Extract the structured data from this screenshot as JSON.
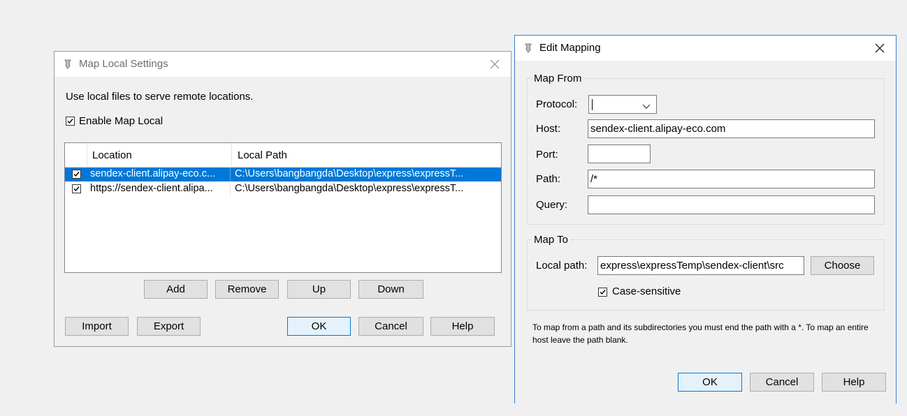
{
  "map_local": {
    "title": "Map Local Settings",
    "description": "Use local files to serve remote locations.",
    "enable_label": "Enable Map Local",
    "enable_checked": true,
    "columns": [
      "Location",
      "Local Path"
    ],
    "rows": [
      {
        "checked": true,
        "selected": true,
        "location": "sendex-client.alipay-eco.c...",
        "local_path": "C:\\Users\\bangbangda\\Desktop\\express\\expressT..."
      },
      {
        "checked": true,
        "selected": false,
        "location": "https://sendex-client.alipa...",
        "local_path": "C:\\Users\\bangbangda\\Desktop\\express\\expressT..."
      }
    ],
    "buttons": {
      "add": "Add",
      "remove": "Remove",
      "up": "Up",
      "down": "Down",
      "import": "Import",
      "export": "Export",
      "ok": "OK",
      "cancel": "Cancel",
      "help": "Help"
    }
  },
  "edit_mapping": {
    "title": "Edit Mapping",
    "map_from": {
      "legend": "Map From",
      "protocol_label": "Protocol:",
      "protocol_value": "",
      "host_label": "Host:",
      "host_value": "sendex-client.alipay-eco.com",
      "port_label": "Port:",
      "port_value": "",
      "path_label": "Path:",
      "path_value": "/*",
      "query_label": "Query:",
      "query_value": ""
    },
    "map_to": {
      "legend": "Map To",
      "local_path_label": "Local path:",
      "local_path_value": "express\\expressTemp\\sendex-client\\src",
      "choose_label": "Choose",
      "case_sensitive_label": "Case-sensitive",
      "case_sensitive_checked": true
    },
    "note": "To map from a path and its subdirectories you must end the path with a *. To map an entire host leave the path blank.",
    "buttons": {
      "ok": "OK",
      "cancel": "Cancel",
      "help": "Help"
    }
  },
  "colors": {
    "selection": "#0078d7",
    "dialog_bg": "#f0f0f0",
    "active_border": "#3b7fd6"
  },
  "icons": [
    "charles-app-icon",
    "close-icon",
    "checkbox-checked-icon",
    "chevron-down-icon"
  ]
}
